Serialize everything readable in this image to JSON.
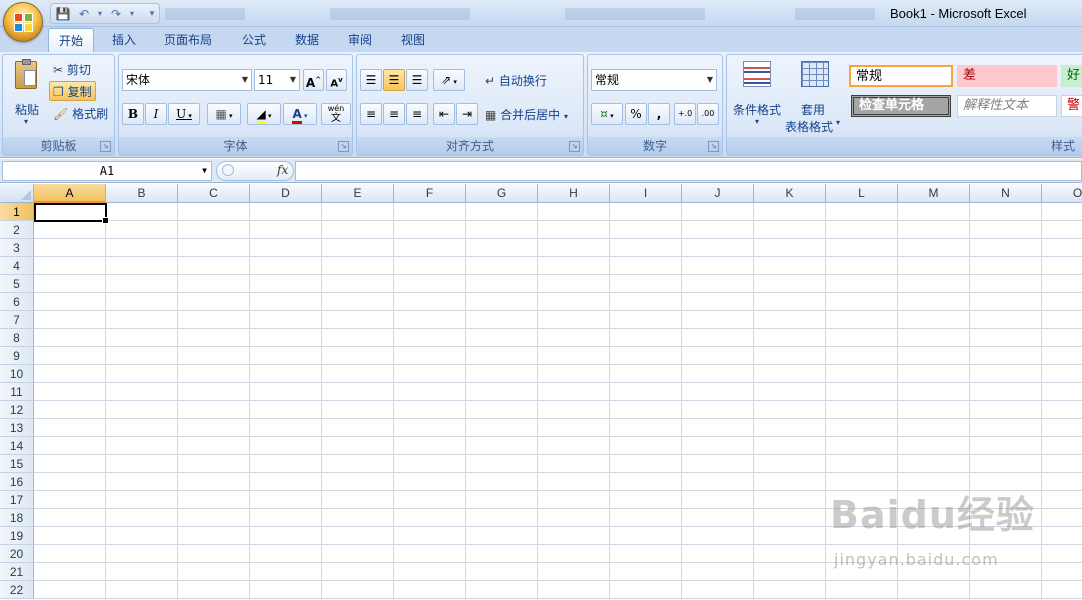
{
  "window": {
    "title": "Book1 - Microsoft Excel"
  },
  "tabs": [
    "开始",
    "插入",
    "页面布局",
    "公式",
    "数据",
    "审阅",
    "视图"
  ],
  "clipboard": {
    "paste": "粘贴",
    "cut": "剪切",
    "copy": "复制",
    "format_painter": "格式刷",
    "label": "剪贴板"
  },
  "font": {
    "name": "宋体",
    "size": "11",
    "label": "字体",
    "bold": "B",
    "italic": "I",
    "underline": "U",
    "grow": "A",
    "shrink": "A",
    "font_color": "A",
    "phonetic": "wén"
  },
  "alignment": {
    "wrap_text": "自动换行",
    "merge_center": "合并后居中",
    "label": "对齐方式"
  },
  "number": {
    "format": "常规",
    "label": "数字",
    "percent": "%",
    "comma": ","
  },
  "styles": {
    "conditional_format": "条件格式",
    "table_format_1": "套用",
    "table_format_2": "表格格式",
    "normal": "常规",
    "bad": "差",
    "good": "好",
    "check_cell": "检查单元格",
    "explanatory": "解释性文本",
    "warning": "警",
    "label": "样式"
  },
  "formula_bar": {
    "name_box": "A1",
    "fx": "fx",
    "value": ""
  },
  "grid": {
    "columns": [
      "A",
      "B",
      "C",
      "D",
      "E",
      "F",
      "G",
      "H",
      "I",
      "J",
      "K",
      "L",
      "M",
      "N",
      "O"
    ],
    "rows": [
      "1",
      "2",
      "3",
      "4",
      "5",
      "6",
      "7",
      "8",
      "9",
      "10",
      "11",
      "12",
      "13",
      "14",
      "15",
      "16",
      "17",
      "18",
      "19",
      "20",
      "21",
      "22"
    ],
    "active_cell": "A1"
  },
  "watermark": {
    "logo": "Baidu经验",
    "url": "jingyan.baidu.com"
  },
  "colors": {
    "accent": "#15428b",
    "selection": "#f1c15f",
    "bad_bg": "#ffc7ce",
    "good_bg": "#c6efce",
    "warning_fg": "#c00000"
  }
}
